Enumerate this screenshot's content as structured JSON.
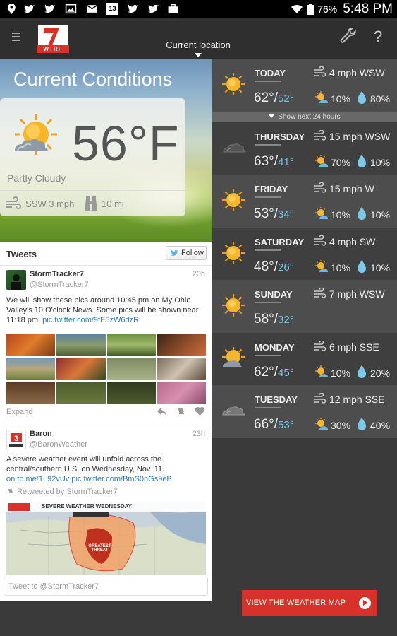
{
  "status_bar": {
    "icons": [
      "location-icon",
      "twitter-icon",
      "twitter-icon",
      "image-icon",
      "gmail-icon",
      "calendar-icon",
      "twitter-icon",
      "twitter-icon",
      "briefcase-icon"
    ],
    "calendar_day": "13",
    "battery": "76%",
    "time": "5:48 PM"
  },
  "app_bar": {
    "logo_number": "7",
    "logo_text": "WTRF",
    "location_label": "Current location",
    "help_label": "?"
  },
  "current": {
    "title": "Current Conditions",
    "temperature": "56°F",
    "condition": "Partly Cloudy",
    "wind": "SSW 3 mph",
    "visibility": "10 mi"
  },
  "tweets": {
    "header": "Tweets",
    "follow_label": "Follow",
    "items": [
      {
        "name": "StormTracker7",
        "handle": "@StormTracker7",
        "time": "20h",
        "text": "We will show these pics around 10:45 pm on My Ohio Valley's 10 O'clock News. Some pics will be shown near 11:18 pm.",
        "link": "pic.twitter.com/9fE5zW6dzR",
        "expand": "Expand"
      },
      {
        "name": "Baron",
        "handle": "@BaronWeather",
        "time": "23h",
        "text": "A severe weather event will unfold across the central/southern U.S. on Wednesday, Nov. 11.",
        "link": "on.fb.me/1L92vUv pic.twitter.com/BmS0nGs9eB",
        "retweeted": "Retweeted by StormTracker7",
        "map_banner": "SEVERE WEATHER WEDNESDAY",
        "map_threat": "GREATEST THREAT"
      }
    ],
    "input_placeholder": "Tweet to @StormTracker7"
  },
  "forecast": {
    "show_next": "Show next 24 hours",
    "days": [
      {
        "name": "TODAY",
        "wind": "4 mph WSW",
        "hi": "62°",
        "lo": "52°",
        "sun": "10%",
        "precip": "80%",
        "icon": "sun-icon"
      },
      {
        "name": "THURSDAY",
        "wind": "15 mph WSW",
        "hi": "63°",
        "lo": "41°",
        "sun": "70%",
        "precip": "10%",
        "icon": "storm-cloud-icon"
      },
      {
        "name": "FRIDAY",
        "wind": "15 mph W",
        "hi": "53°",
        "lo": "34°",
        "sun": "10%",
        "precip": "10%",
        "icon": "sun-icon"
      },
      {
        "name": "SATURDAY",
        "wind": "4 mph SW",
        "hi": "48°",
        "lo": "26°",
        "sun": "10%",
        "precip": "10%",
        "icon": "sun-icon"
      },
      {
        "name": "SUNDAY",
        "wind": "7 mph WSW",
        "hi": "58°",
        "lo": "32°",
        "sun": "",
        "precip": "",
        "icon": "sun-icon"
      },
      {
        "name": "MONDAY",
        "wind": "6 mph SSE",
        "hi": "62°",
        "lo": "45°",
        "sun": "10%",
        "precip": "20%",
        "icon": "partly-cloudy-icon"
      },
      {
        "name": "TUESDAY",
        "wind": "12 mph SSE",
        "hi": "66°",
        "lo": "53°",
        "sun": "30%",
        "precip": "40%",
        "icon": "cloud-icon"
      }
    ]
  },
  "map_button": {
    "label": "VIEW THE WEATHER MAP"
  },
  "colors": {
    "accent": "#d8312a",
    "lo_temp": "#73c6e6",
    "link": "#2b7bb9"
  }
}
